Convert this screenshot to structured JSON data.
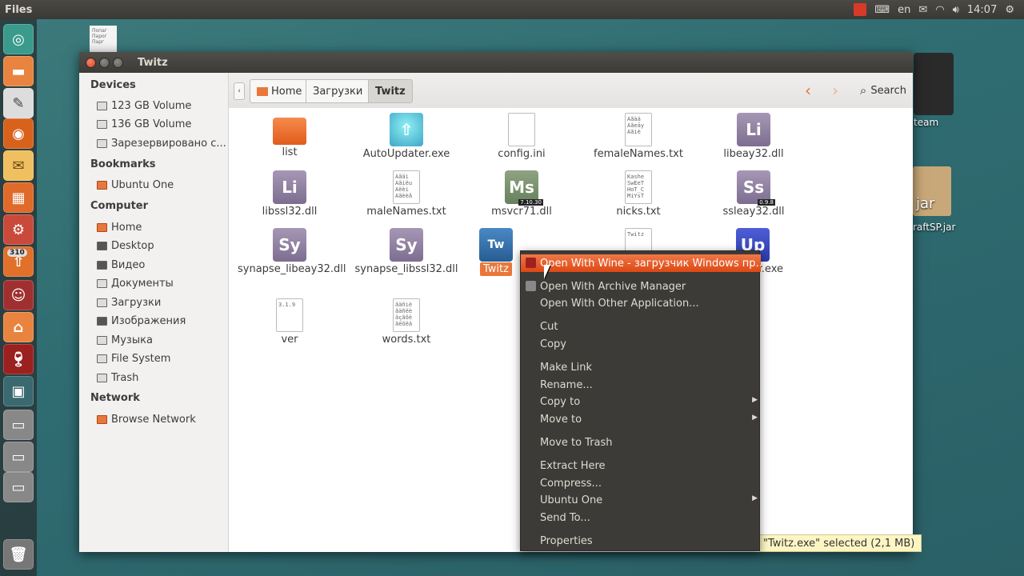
{
  "top_panel": {
    "app_title": "Files",
    "keyboard_layout": "en",
    "clock": "14:07"
  },
  "launcher": {
    "badge_count": "310",
    "items": [
      "ubuntu-dash-icon",
      "home-folder-icon",
      "text-editor-icon",
      "firefox-icon",
      "mail-icon",
      "software-center-icon",
      "system-settings-icon",
      "updates-icon",
      "chat-icon",
      "files-icon",
      "wine-icon",
      "terminal-icon",
      "drive-1-icon",
      "drive-2-icon",
      "drive-3-icon",
      "trash-icon"
    ]
  },
  "desktop": {
    "doc_icon_text": "Попаг\nПарог\nПарг",
    "steam_label": "team",
    "jar_label": "raftSP.jar",
    "jar_icon_text": "jar"
  },
  "window": {
    "title": "Twitz"
  },
  "sidebar": {
    "sections": [
      {
        "header": "Devices",
        "items": [
          "123 GB Volume",
          "136 GB Volume",
          "Зарезервировано с..."
        ]
      },
      {
        "header": "Bookmarks",
        "items": [
          "Ubuntu One"
        ]
      },
      {
        "header": "Computer",
        "items": [
          "Home",
          "Desktop",
          "Видео",
          "Документы",
          "Загрузки",
          "Изображения",
          "Музыка",
          "File System",
          "Trash"
        ]
      },
      {
        "header": "Network",
        "items": [
          "Browse Network"
        ]
      }
    ]
  },
  "toolbar": {
    "breadcrumbs": [
      "Home",
      "Загрузки",
      "Twitz"
    ],
    "search_label": "Search"
  },
  "files": [
    {
      "name": "list",
      "icon": "folder-icon"
    },
    {
      "name": "AutoUpdater.exe",
      "icon": "updater-icon"
    },
    {
      "name": "config.ini",
      "icon": "text-file-icon",
      "preview": ""
    },
    {
      "name": "femaleNames.txt",
      "icon": "text-file-icon",
      "preview": "Aãàá\nAãeāy\nAãiè"
    },
    {
      "name": "libeay32.dll",
      "icon": "library-icon",
      "glyph": "Li"
    },
    {
      "name": "libssl32.dll",
      "icon": "library-icon",
      "glyph": "Li"
    },
    {
      "name": "maleNames.txt",
      "icon": "text-file-icon",
      "preview": "Aãäi\nAãiëu\nAëèi\nAãèèã"
    },
    {
      "name": "msvcr71.dll",
      "icon": "library-icon",
      "glyph": "Ms",
      "tag": "7.10.30"
    },
    {
      "name": "nicks.txt",
      "icon": "text-file-icon",
      "preview": "Kashe\nSwEeT\nHoT_C\nMiYsT"
    },
    {
      "name": "ssleay32.dll",
      "icon": "library-icon",
      "glyph": "Ss",
      "tag": "0.9.8"
    },
    {
      "name": "synapse_libeay32.dll",
      "icon": "library-icon",
      "glyph": "Sy"
    },
    {
      "name": "synapse_libssl32.dll",
      "icon": "library-icon",
      "glyph": "Sy"
    },
    {
      "name": "Twitz",
      "icon": "twitz-app-icon",
      "glyph": "Tw"
    },
    {
      "name": "",
      "icon": "text-file-icon",
      "preview": "Twitz"
    },
    {
      "name": "r.exe",
      "icon": "updater-exe-icon",
      "glyph": "Up"
    },
    {
      "name": "ver",
      "icon": "text-file-icon",
      "preview": "3.1.9"
    },
    {
      "name": "words.txt",
      "icon": "text-file-icon",
      "preview": "ãäñiè\nãäñëè\näçãõè\nãëõëä"
    }
  ],
  "context_menu": {
    "items": [
      {
        "label": "Open With Wine - загрузчик Windows пр…",
        "icon": "wine-icon",
        "highlighted": true
      },
      {
        "label": "Open With Archive Manager",
        "icon": "archive-manager-icon"
      },
      {
        "label": "Open With Other Application..."
      },
      {
        "label": "Cut"
      },
      {
        "label": "Copy"
      },
      {
        "label": "Make Link"
      },
      {
        "label": "Rename..."
      },
      {
        "label": "Copy to",
        "submenu": true
      },
      {
        "label": "Move to",
        "submenu": true
      },
      {
        "label": "Move to Trash"
      },
      {
        "label": "Extract Here"
      },
      {
        "label": "Compress..."
      },
      {
        "label": "Ubuntu One",
        "submenu": true
      },
      {
        "label": "Send To..."
      },
      {
        "label": "Properties"
      }
    ]
  },
  "statusbar": {
    "text": "\"Twitz.exe\" selected (2,1 MB)"
  },
  "colors": {
    "accent": "#e9773b",
    "menu_bg": "#3c3b37",
    "panel_bg": "#3c3b37"
  }
}
